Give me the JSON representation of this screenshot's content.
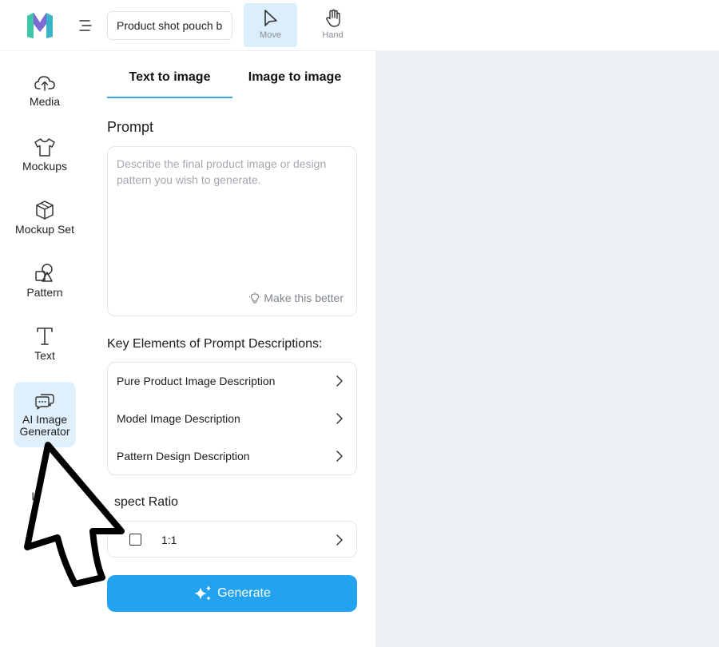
{
  "topbar": {
    "project_name": "Product shot pouch b",
    "tools": [
      {
        "label": "Move",
        "icon": "arrow-pointer-icon",
        "active": true
      },
      {
        "label": "Hand",
        "icon": "hand-icon",
        "active": false
      }
    ]
  },
  "sidebar": {
    "items": [
      {
        "label": "Media",
        "icon": "cloud-upload-icon"
      },
      {
        "label": "Mockups",
        "icon": "tshirt-icon"
      },
      {
        "label": "Mockup Set",
        "icon": "cube-icon"
      },
      {
        "label": "Pattern",
        "icon": "shapes-icon"
      },
      {
        "label": "Text",
        "icon": "text-t-icon"
      },
      {
        "label": "AI Image Generator",
        "label_line1": "AI Image",
        "label_line2": "Generator",
        "icon": "chat-bubbles-icon",
        "active": true
      },
      {
        "label": "Im",
        "icon": "image-icon"
      }
    ]
  },
  "panel": {
    "tabs": [
      "Text to image",
      "Image to image"
    ],
    "active_tab": "Text to image",
    "prompt_title": "Prompt",
    "prompt_placeholder": "Describe the final product image or design pattern you wish to generate.",
    "make_better_label": "Make this better",
    "key_elements_title": "Key Elements of Prompt Descriptions:",
    "key_elements": [
      "Pure Product Image Description",
      "Model Image Description",
      "Pattern Design Description"
    ],
    "aspect_ratio_title": "Aspect Ratio",
    "aspect_ratio_visible": "spect Ratio",
    "aspect_ratio_value": "1:1",
    "generate_label": "Generate"
  },
  "colors": {
    "accent": "#23a2ef",
    "tab_underline": "#38a6ec",
    "active_bg": "#dff0fc",
    "canvas_bg": "#eef1f4"
  }
}
